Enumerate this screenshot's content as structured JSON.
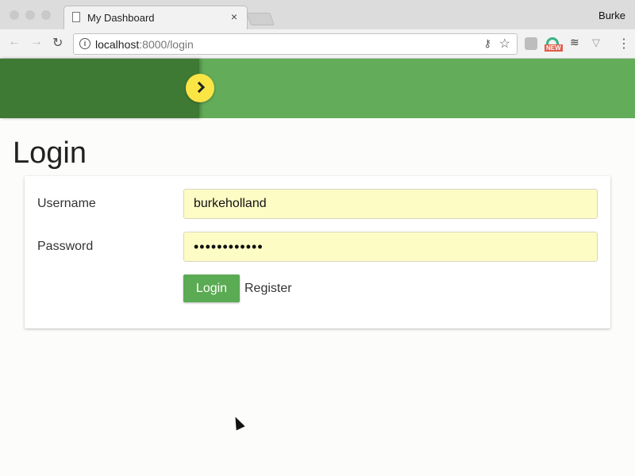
{
  "browser": {
    "tab_title": "My Dashboard",
    "tab_close": "×",
    "profile_name": "Burke",
    "url_host": "localhost",
    "url_rest": ":8000/login",
    "ext_badge": "NEW"
  },
  "app": {
    "page_title": "Login",
    "form": {
      "username_label": "Username",
      "username_value": "burkeholland",
      "password_label": "Password",
      "password_value": "••••••••••••",
      "login_button": "Login",
      "register_link": "Register"
    }
  },
  "colors": {
    "appbar": "#63ac59",
    "drawer": "#3f7a34",
    "toggle": "#fbe545",
    "input_bg": "#fdfcc5",
    "button": "#5aab53"
  }
}
